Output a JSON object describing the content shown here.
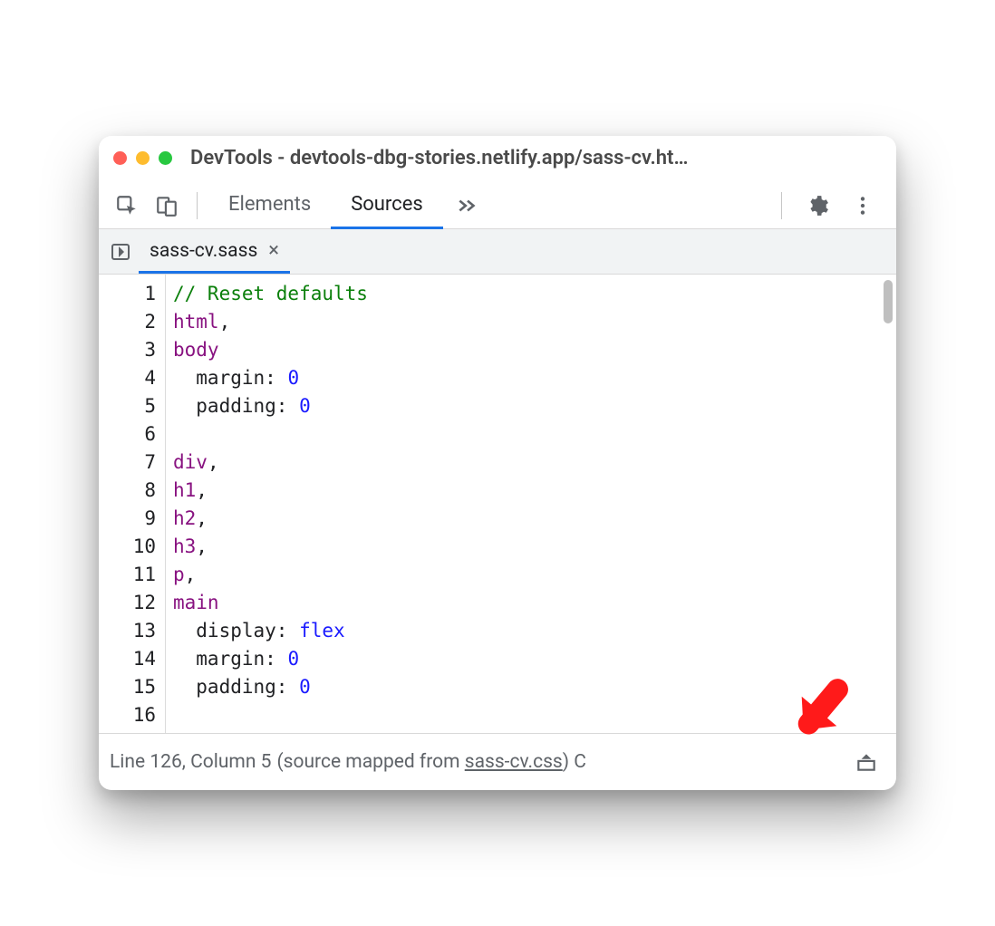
{
  "window": {
    "title": "DevTools - devtools-dbg-stories.netlify.app/sass-cv.ht…"
  },
  "toolbar": {
    "inspect_icon": "inspect",
    "device_icon": "device-toggle",
    "settings_icon": "gear",
    "menu_icon": "kebab",
    "more_panels_icon": "chevrons"
  },
  "panels": [
    {
      "label": "Elements",
      "active": false
    },
    {
      "label": "Sources",
      "active": true
    }
  ],
  "file_tab": {
    "name": "sass-cv.sass",
    "close_label": "×"
  },
  "editor": {
    "lines": [
      {
        "n": 1,
        "segs": [
          {
            "t": "// Reset defaults",
            "c": "cm-comment"
          }
        ]
      },
      {
        "n": 2,
        "segs": [
          {
            "t": "html",
            "c": "cm-tag"
          },
          {
            "t": ",",
            "c": ""
          }
        ]
      },
      {
        "n": 3,
        "segs": [
          {
            "t": "body",
            "c": "cm-tag"
          }
        ]
      },
      {
        "n": 4,
        "segs": [
          {
            "t": "  margin: ",
            "c": "cm-prop"
          },
          {
            "t": "0",
            "c": "cm-num"
          }
        ]
      },
      {
        "n": 5,
        "segs": [
          {
            "t": "  padding: ",
            "c": "cm-prop"
          },
          {
            "t": "0",
            "c": "cm-num"
          }
        ]
      },
      {
        "n": 6,
        "segs": [
          {
            "t": "",
            "c": ""
          }
        ]
      },
      {
        "n": 7,
        "segs": [
          {
            "t": "div",
            "c": "cm-tag"
          },
          {
            "t": ",",
            "c": ""
          }
        ]
      },
      {
        "n": 8,
        "segs": [
          {
            "t": "h1",
            "c": "cm-tag"
          },
          {
            "t": ",",
            "c": ""
          }
        ]
      },
      {
        "n": 9,
        "segs": [
          {
            "t": "h2",
            "c": "cm-tag"
          },
          {
            "t": ",",
            "c": ""
          }
        ]
      },
      {
        "n": 10,
        "segs": [
          {
            "t": "h3",
            "c": "cm-tag"
          },
          {
            "t": ",",
            "c": ""
          }
        ]
      },
      {
        "n": 11,
        "segs": [
          {
            "t": "p",
            "c": "cm-tag"
          },
          {
            "t": ",",
            "c": ""
          }
        ]
      },
      {
        "n": 12,
        "segs": [
          {
            "t": "main",
            "c": "cm-tag"
          }
        ]
      },
      {
        "n": 13,
        "segs": [
          {
            "t": "  display: ",
            "c": "cm-prop"
          },
          {
            "t": "flex",
            "c": "cm-val"
          }
        ]
      },
      {
        "n": 14,
        "segs": [
          {
            "t": "  margin: ",
            "c": "cm-prop"
          },
          {
            "t": "0",
            "c": "cm-num"
          }
        ]
      },
      {
        "n": 15,
        "segs": [
          {
            "t": "  padding: ",
            "c": "cm-prop"
          },
          {
            "t": "0",
            "c": "cm-num"
          }
        ]
      },
      {
        "n": 16,
        "segs": [
          {
            "t": "",
            "c": ""
          }
        ]
      }
    ]
  },
  "status": {
    "position": "Line 126, Column 5",
    "mapped_prefix": "(source mapped from ",
    "mapped_link": "sass-cv.css",
    "mapped_suffix": ")",
    "truncated_tail": " C"
  }
}
